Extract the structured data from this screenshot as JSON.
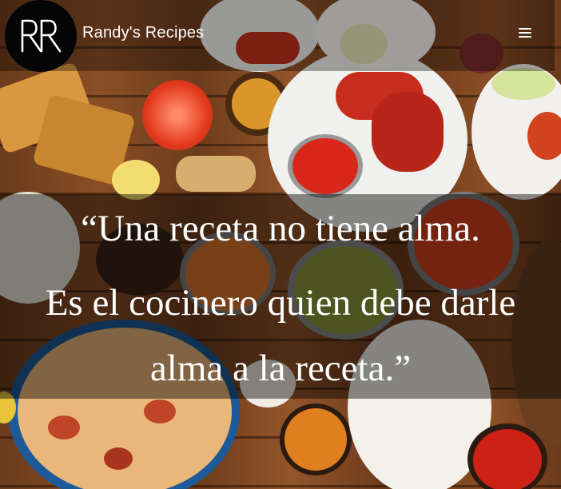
{
  "header": {
    "brand": "Randy's Recipes",
    "logo_text": "RR",
    "menu_icon": "hamburger-menu-icon"
  },
  "hero": {
    "quote_line_1": "“Una receta no tiene alma.",
    "quote_line_2": "Es el cocinero quien debe darle",
    "quote_line_3": "alma a la receta.”"
  },
  "colors": {
    "navbar_overlay": "#000000",
    "quote_overlay": "#000000",
    "text": "#ffffff"
  }
}
